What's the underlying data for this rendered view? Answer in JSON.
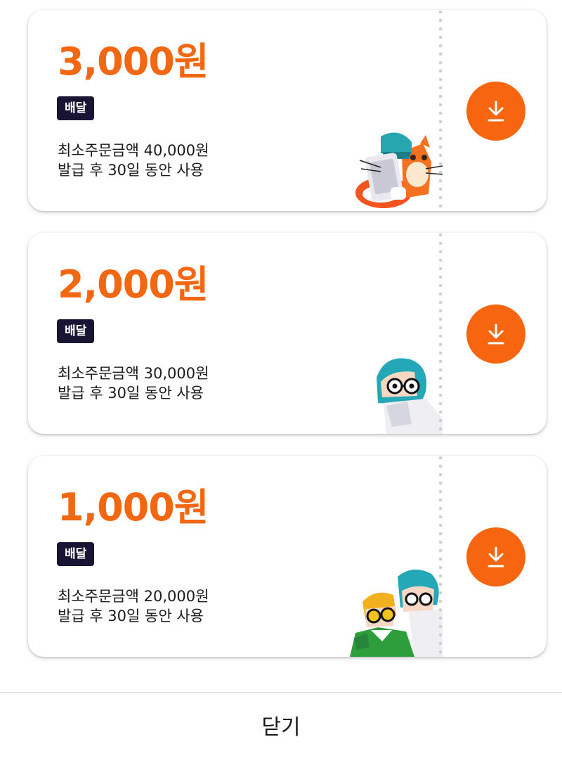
{
  "coupons": [
    {
      "amount": "3,000원",
      "tag": "배달",
      "min_order": "최소주문금액 40,000원",
      "validity": "발급 후 30일 동안 사용",
      "illustration": "cat-with-tablet-illustration",
      "action_icon": "download-icon"
    },
    {
      "amount": "2,000원",
      "tag": "배달",
      "min_order": "최소주문금액 30,000원",
      "validity": "발급 후 30일 동안 사용",
      "illustration": "peeking-character-illustration",
      "action_icon": "download-icon"
    },
    {
      "amount": "1,000원",
      "tag": "배달",
      "min_order": "최소주문금액 20,000원",
      "validity": "발급 후 30일 동안 사용",
      "illustration": "two-characters-illustration",
      "action_icon": "download-icon"
    }
  ],
  "footer": {
    "close_label": "닫기"
  },
  "colors": {
    "accent": "#f26712",
    "download_button": "#f7660f",
    "tag_background": "#181434",
    "text": "#1a1a1a"
  }
}
